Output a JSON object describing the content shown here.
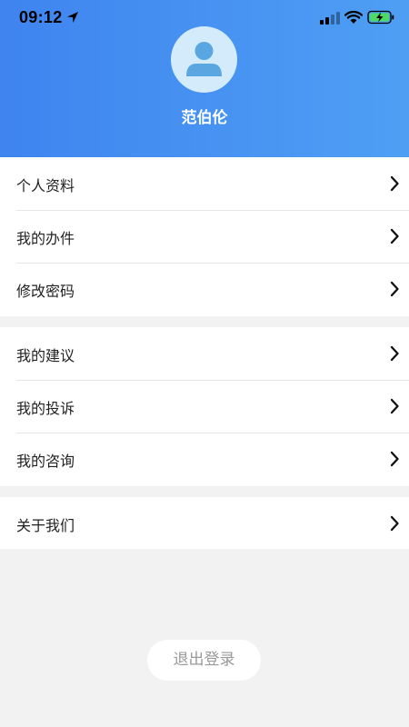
{
  "status_bar": {
    "time": "09:12",
    "icons": [
      "location-arrow-icon",
      "cellular-signal-icon",
      "wifi-icon",
      "battery-charging-icon"
    ]
  },
  "profile": {
    "avatar_icon": "user-avatar-icon",
    "name": "范伯伦"
  },
  "menu": {
    "group1": [
      "个人资料",
      "我的办件",
      "修改密码"
    ],
    "group2": [
      "我的建议",
      "我的投诉",
      "我的咨询"
    ],
    "group3": [
      "关于我们"
    ]
  },
  "logout_label": "退出登录",
  "colors": {
    "header_gradient_start": "#3f84ef",
    "header_gradient_end": "#4e9ff4",
    "page_background": "#f2f2f2",
    "avatar_background": "#d4ebfb",
    "avatar_figure": "#5aa6e0",
    "battery_fill": "#4cd964"
  }
}
